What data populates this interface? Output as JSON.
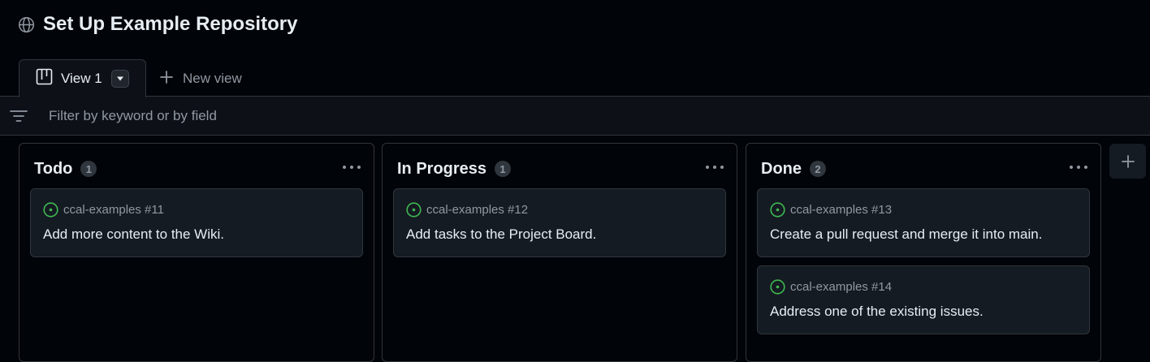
{
  "project": {
    "title": "Set Up Example Repository",
    "icon": "globe-icon"
  },
  "tabs": {
    "active": {
      "label": "View 1",
      "icon": "board-icon",
      "dropdown_icon": "triangle-down-icon"
    },
    "new_view": {
      "label": "New view",
      "icon": "plus-icon"
    }
  },
  "filter": {
    "placeholder": "Filter by keyword or by field",
    "value": "",
    "icon": "filter-icon"
  },
  "columns": [
    {
      "name": "Todo",
      "count": "1",
      "cards": [
        {
          "repo": "ccal-examples #11",
          "title": "Add more content to the Wiki.",
          "icon": "issue-open-icon"
        }
      ]
    },
    {
      "name": "In Progress",
      "count": "1",
      "cards": [
        {
          "repo": "ccal-examples #12",
          "title": "Add tasks to the Project Board.",
          "icon": "issue-open-icon"
        }
      ]
    },
    {
      "name": "Done",
      "count": "2",
      "cards": [
        {
          "repo": "ccal-examples #13",
          "title": "Create a pull request and merge it into main.",
          "icon": "issue-open-icon"
        },
        {
          "repo": "ccal-examples #14",
          "title": "Address one of the existing issues.",
          "icon": "issue-open-icon"
        }
      ]
    }
  ],
  "colors": {
    "background": "#010409",
    "surface": "#0d1117",
    "card": "#151b23",
    "border": "#30363d",
    "text": "#e6edf3",
    "muted": "#9198a1",
    "issue_open": "#3fb950"
  }
}
